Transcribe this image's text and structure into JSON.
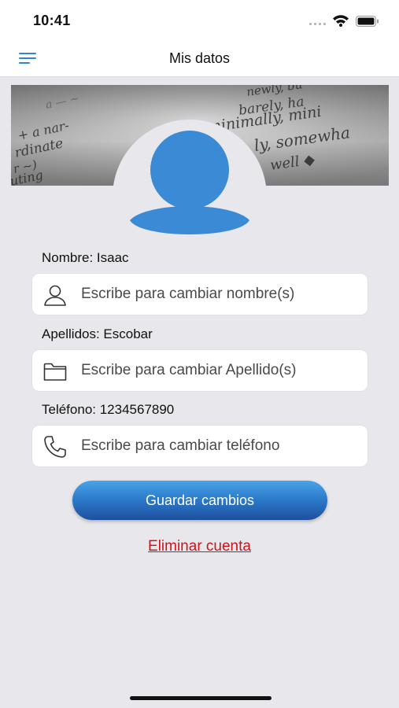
{
  "status_bar": {
    "time": "10:41"
  },
  "nav": {
    "title": "Mis datos"
  },
  "form": {
    "nombre": {
      "label": "Nombre: Isaac",
      "placeholder": "Escribe para cambiar nombre(s)",
      "value": ""
    },
    "apellidos": {
      "label": "Apellidos: Escobar",
      "placeholder": "Escribe para cambiar Apellido(s)",
      "value": ""
    },
    "telefono": {
      "label": "Teléfono: 1234567890",
      "placeholder": "Escribe para cambiar teléfono",
      "value": ""
    }
  },
  "actions": {
    "save_label": "Guardar cambios",
    "delete_label": "Eliminar cuenta"
  },
  "icons": {
    "menu": "hamburger-menu-icon",
    "avatar": "user-avatar-icon",
    "nombre": "person-icon",
    "apellidos": "folder-icon",
    "telefono": "phone-icon"
  },
  "colors": {
    "accent": "#2c86d8",
    "avatar": "#3a8ad6",
    "danger": "#c9161c",
    "button_top": "#4aa3e8",
    "button_bottom": "#1f4f9e"
  }
}
